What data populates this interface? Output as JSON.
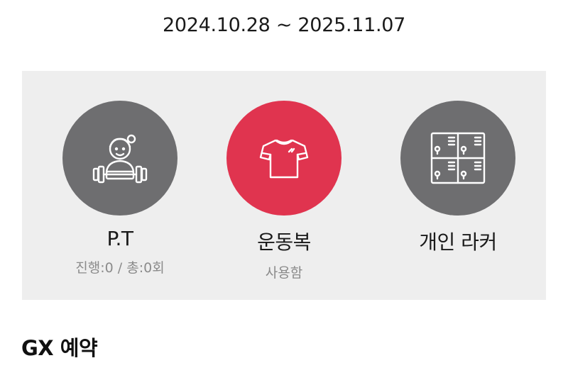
{
  "membership": {
    "period": "2024.10.28 ~ 2025.11.07"
  },
  "services": [
    {
      "label": "P.T",
      "sub": "진행:0 / 총:0회",
      "icon": "trainer-icon",
      "color": "#6e6e70"
    },
    {
      "label": "운동복",
      "sub": "사용함",
      "icon": "shirt-icon",
      "color": "#e0344f"
    },
    {
      "label": "개인 라커",
      "sub": "",
      "icon": "locker-icon",
      "color": "#6e6e70"
    }
  ],
  "gx": {
    "title": "GX 예약"
  }
}
